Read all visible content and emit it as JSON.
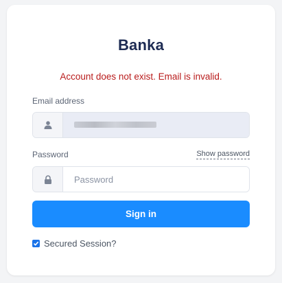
{
  "brand": {
    "title": "Banka"
  },
  "alert": {
    "error_message": "Account does not exist. Email is invalid."
  },
  "email": {
    "label": "Email address",
    "value": ""
  },
  "password": {
    "label": "Password",
    "placeholder": "Password",
    "show_label": "Show password"
  },
  "signin": {
    "button_label": "Sign in"
  },
  "session": {
    "label": "Secured Session?",
    "checked": true
  },
  "colors": {
    "accent": "#1a8cff",
    "error": "#b91c1c",
    "title": "#1d2b53"
  }
}
